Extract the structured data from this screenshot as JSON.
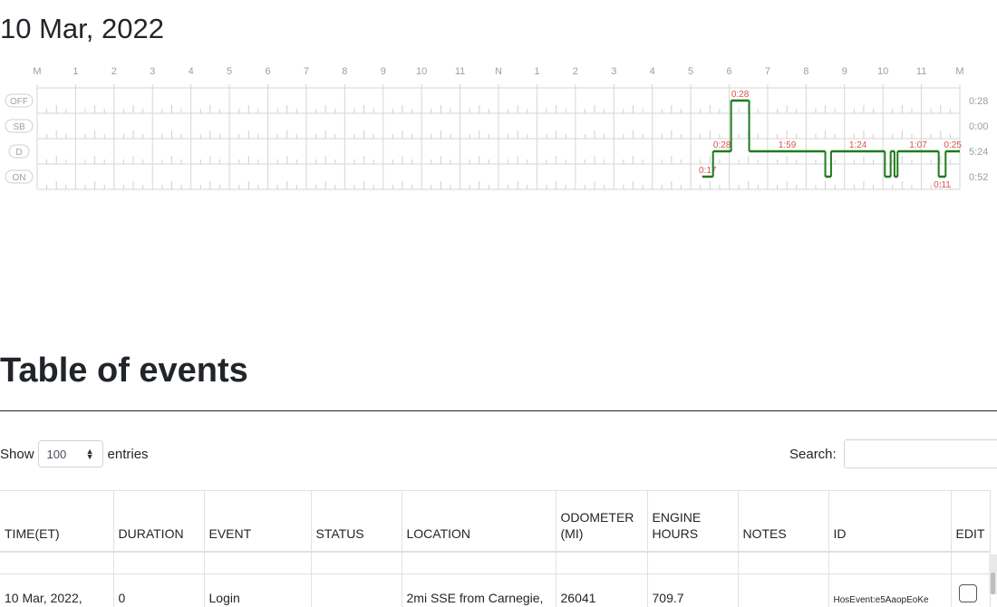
{
  "log": {
    "date": "10 Mar, 2022",
    "hour_labels": [
      "M",
      "1",
      "2",
      "3",
      "4",
      "5",
      "6",
      "7",
      "8",
      "9",
      "10",
      "11",
      "N",
      "1",
      "2",
      "3",
      "4",
      "5",
      "6",
      "7",
      "8",
      "9",
      "10",
      "11",
      "M"
    ],
    "statuses": [
      {
        "code": "OFF",
        "total": "0:28"
      },
      {
        "code": "SB",
        "total": "0:00"
      },
      {
        "code": "D",
        "total": "5:24"
      },
      {
        "code": "ON",
        "total": "0:52"
      }
    ],
    "segments": [
      {
        "status": "ON",
        "start": 17.3,
        "end": 17.58,
        "label": "0:17"
      },
      {
        "status": "D",
        "start": 17.58,
        "end": 18.05,
        "label": "0:28"
      },
      {
        "status": "OFF",
        "start": 18.05,
        "end": 18.52,
        "label": "0:28"
      },
      {
        "status": "D",
        "start": 18.52,
        "end": 20.5,
        "label": "1:59"
      },
      {
        "status": "ON",
        "start": 20.5,
        "end": 20.65,
        "label": ""
      },
      {
        "status": "D",
        "start": 20.65,
        "end": 22.05,
        "label": "1:24"
      },
      {
        "status": "ON",
        "start": 22.05,
        "end": 22.2,
        "label": ""
      },
      {
        "status": "D",
        "start": 22.2,
        "end": 22.3,
        "label": ""
      },
      {
        "status": "ON",
        "start": 22.3,
        "end": 22.38,
        "label": ""
      },
      {
        "status": "D",
        "start": 22.38,
        "end": 23.45,
        "label": "1:07"
      },
      {
        "status": "ON",
        "start": 23.45,
        "end": 23.63,
        "label": "0:11"
      },
      {
        "status": "D",
        "start": 23.63,
        "end": 24.0,
        "label": "0:25"
      }
    ],
    "line_color": "#1e7b1e",
    "label_color": "#d9534f"
  },
  "section": {
    "title": "Table of events"
  },
  "controls": {
    "show_label": "Show",
    "entries_value": "100",
    "entries_label": "entries",
    "search_label": "Search:",
    "search_value": ""
  },
  "table": {
    "headers": [
      {
        "line1": "TIME(ET)",
        "line2": ""
      },
      {
        "line1": "DURATION",
        "line2": ""
      },
      {
        "line1": "EVENT",
        "line2": ""
      },
      {
        "line1": "STATUS",
        "line2": ""
      },
      {
        "line1": "LOCATION",
        "line2": ""
      },
      {
        "line1": "ODOMETER",
        "line2": "(MI)"
      },
      {
        "line1": "ENGINE",
        "line2": "HOURS"
      },
      {
        "line1": "NOTES",
        "line2": ""
      },
      {
        "line1": "ID",
        "line2": ""
      },
      {
        "line1": "EDIT",
        "line2": ""
      }
    ],
    "rows": [
      {
        "time": "10 Mar, 2022,",
        "duration": "0",
        "event": "Login",
        "status": "",
        "location": "2mi SSE from Carnegie,",
        "odometer": "26041",
        "engine_hours": "709.7",
        "notes": "",
        "id": "HosEvent:e5AaopEoKe"
      }
    ]
  }
}
